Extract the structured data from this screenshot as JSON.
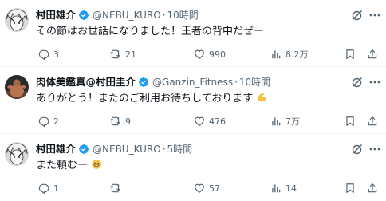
{
  "tweets": [
    {
      "name": "村田雄介",
      "handle": "@NEBU_KURO",
      "dot": "·",
      "time": "10時間",
      "text": "その節はお世話になりました！王者の背中だぜー",
      "emoji": "",
      "replies": "3",
      "reposts": "21",
      "likes": "990",
      "views": "8.2万"
    },
    {
      "name": "肉体美鑑真@村田圭介",
      "handle": "@Ganzin_Fitness",
      "dot": "·",
      "time": "10時間",
      "text": "ありがとう！またのご利用お待ちしております",
      "emoji": "flexed-biceps",
      "replies": "2",
      "reposts": "9",
      "likes": "476",
      "views": "7万"
    },
    {
      "name": "村田雄介",
      "handle": "@NEBU_KURO",
      "dot": "·",
      "time": "5時間",
      "text": "また頼むー",
      "emoji": "grinning-face",
      "replies": "1",
      "reposts": "",
      "likes": "57",
      "views": "14"
    }
  ],
  "colors": {
    "verified": "#1d9bf0",
    "secondary_text": "#536471",
    "primary_text": "#0f1419",
    "divider": "#eff3f4"
  },
  "icons": [
    "grok-icon",
    "more-icon",
    "reply-icon",
    "repost-icon",
    "like-icon",
    "views-icon",
    "bookmark-icon",
    "share-icon",
    "verified-badge-icon"
  ]
}
